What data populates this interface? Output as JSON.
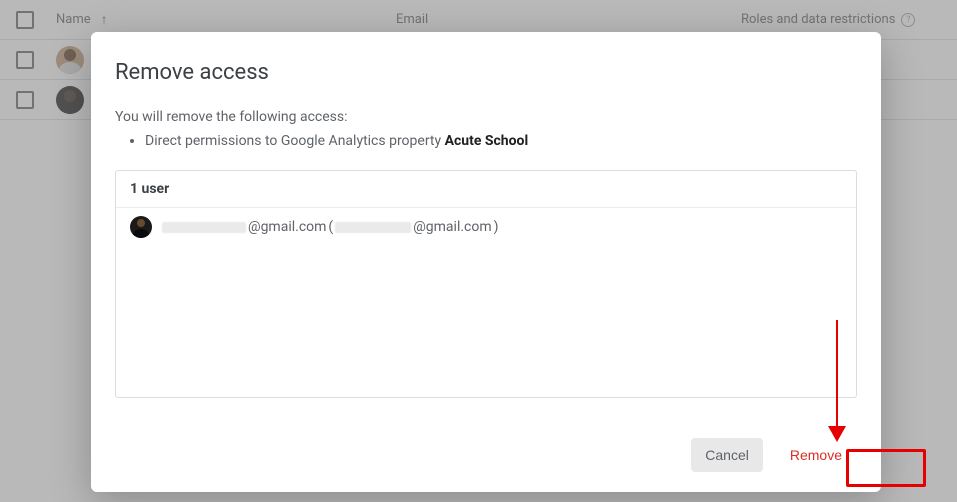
{
  "table": {
    "headers": {
      "name": "Name",
      "email": "Email",
      "roles": "Roles and data restrictions"
    },
    "rows": [
      {},
      {}
    ]
  },
  "dialog": {
    "title": "Remove access",
    "intro": "You will remove the following access:",
    "bullet_prefix": "Direct permissions to Google Analytics property ",
    "bullet_property": "Acute School",
    "user_count_label": "1 user",
    "user": {
      "email_masked_prefix": "",
      "email_domain": "@gmail.com",
      "paren_open": " (",
      "paren_domain": "@gmail.com",
      "paren_close": ")"
    },
    "cancel_label": "Cancel",
    "remove_label": "Remove"
  }
}
